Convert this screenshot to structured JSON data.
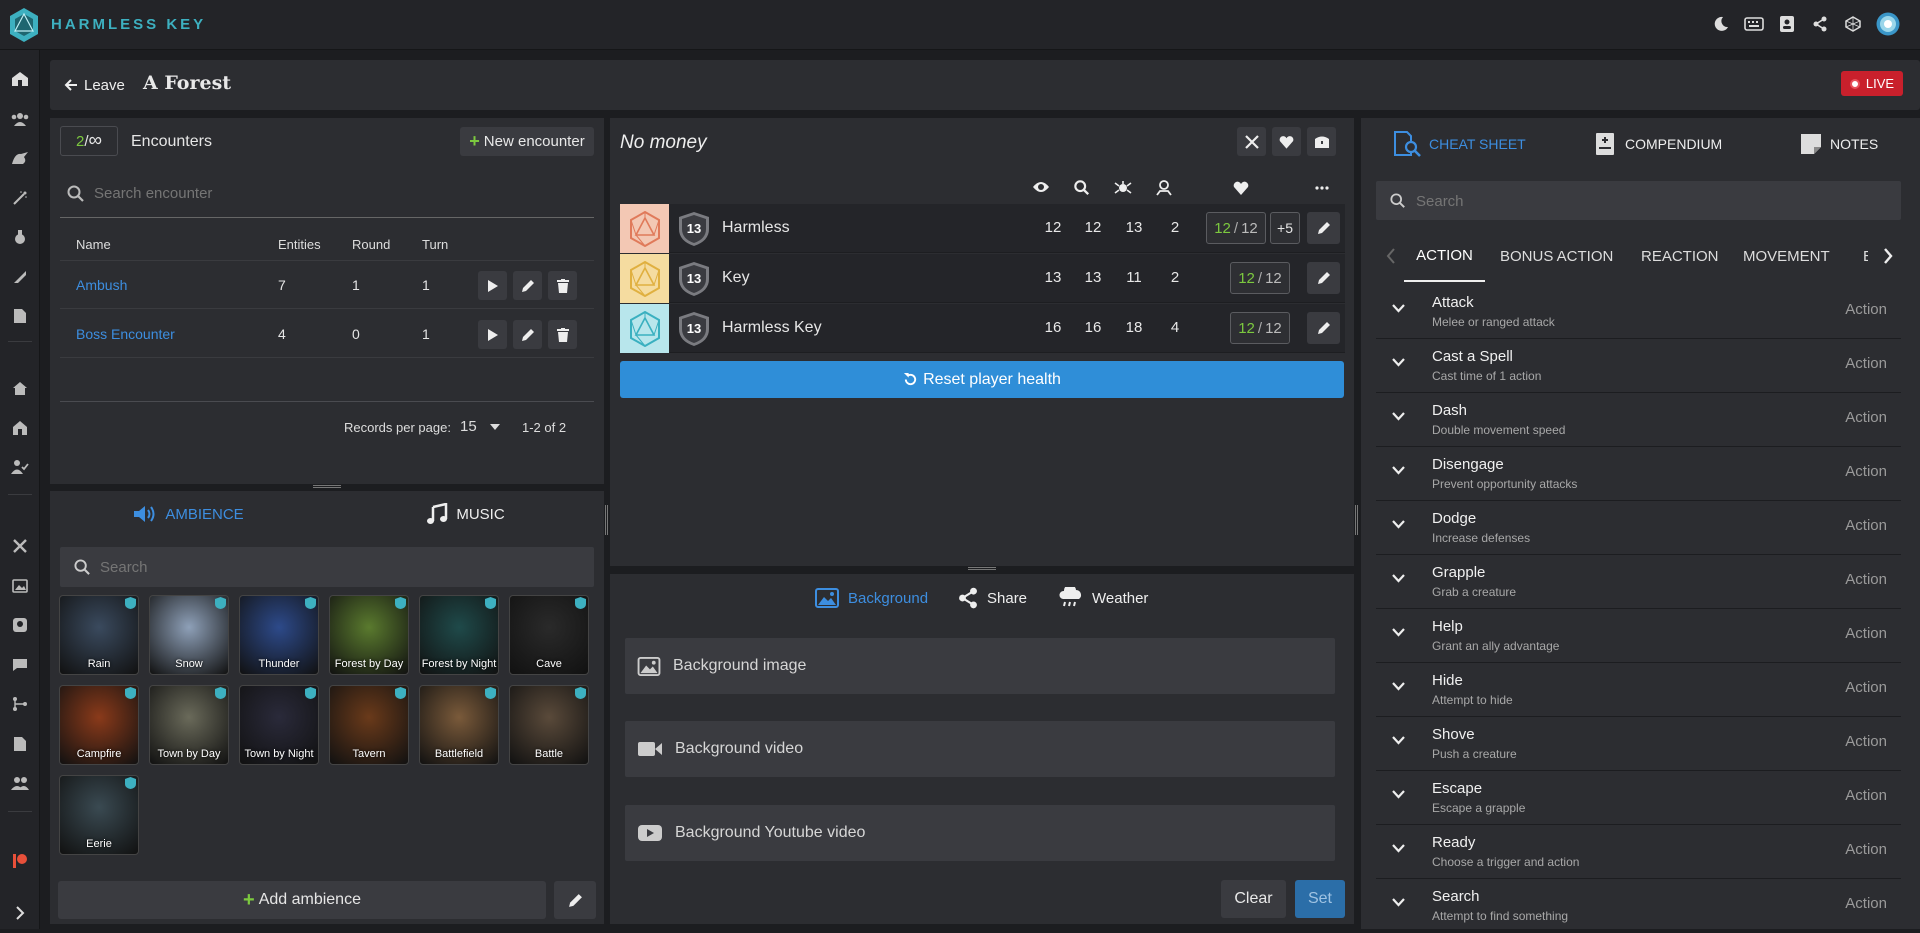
{
  "app": {
    "name": "HARMLESS KEY"
  },
  "header": {
    "leave_label": "Leave",
    "title": "A Forest",
    "live_label": "LIVE"
  },
  "encounters": {
    "count_current": "2",
    "count_sep": " / ",
    "count_max": "∞",
    "title": "Encounters",
    "new_label": "New encounter",
    "search_placeholder": "Search encounter",
    "columns": [
      "Name",
      "Entities",
      "Round",
      "Turn"
    ],
    "rows": [
      {
        "name": "Ambush",
        "entities": "7",
        "round": "1",
        "turn": "1"
      },
      {
        "name": "Boss Encounter",
        "entities": "4",
        "round": "0",
        "turn": "1"
      }
    ],
    "records_label": "Records per page:",
    "records_value": "15",
    "range": "1-2 of 2"
  },
  "ambience": {
    "tab_ambience": "AMBIENCE",
    "tab_music": "MUSIC",
    "search_placeholder": "Search",
    "tiles": [
      {
        "label": "Rain",
        "color": "#3a4a5e"
      },
      {
        "label": "Snow",
        "color": "#8ea0b8"
      },
      {
        "label": "Thunder",
        "color": "#2d4a8a"
      },
      {
        "label": "Forest by Day",
        "color": "#5a7a2e"
      },
      {
        "label": "Forest by Night",
        "color": "#1f4a4a"
      },
      {
        "label": "Cave",
        "color": "#2a2a2a"
      },
      {
        "label": "Campfire",
        "color": "#8a3a1a"
      },
      {
        "label": "Town by Day",
        "color": "#6a6a5a"
      },
      {
        "label": "Town by Night",
        "color": "#2a2a3a"
      },
      {
        "label": "Tavern",
        "color": "#6a3a1a"
      },
      {
        "label": "Battlefield",
        "color": "#7a5a3a"
      },
      {
        "label": "Battle",
        "color": "#5a4a3a"
      },
      {
        "label": "Eerie",
        "color": "#3a4a52"
      }
    ],
    "add_label": "Add ambience"
  },
  "party": {
    "title": "No money",
    "players": [
      {
        "name": "Harmless",
        "ac": "13",
        "v1": "12",
        "v2": "12",
        "v3": "13",
        "v4": "2",
        "hp": "12",
        "hp_max": "12",
        "bonus": "+5",
        "color": "#f3c8b4",
        "die": "#e07a5a"
      },
      {
        "name": "Key",
        "ac": "13",
        "v1": "13",
        "v2": "13",
        "v3": "11",
        "v4": "2",
        "hp": "12",
        "hp_max": "12",
        "bonus": "",
        "color": "#f5dca0",
        "die": "#e0b040"
      },
      {
        "name": "Harmless Key",
        "ac": "13",
        "v1": "16",
        "v2": "16",
        "v3": "18",
        "v4": "4",
        "hp": "12",
        "hp_max": "12",
        "bonus": "",
        "color": "#b8e6ec",
        "die": "#3ab0c0"
      }
    ],
    "reset_label": "Reset player health"
  },
  "background": {
    "tab_background": "Background",
    "tab_share": "Share",
    "tab_weather": "Weather",
    "rows": [
      "Background image",
      "Background video",
      "Background Youtube video"
    ],
    "clear_label": "Clear",
    "set_label": "Set"
  },
  "right": {
    "tab_cheat": "CHEAT SHEET",
    "tab_compendium": "COMPENDIUM",
    "tab_notes": "NOTES",
    "search_placeholder": "Search",
    "subtabs": [
      "ACTION",
      "BONUS ACTION",
      "REACTION",
      "MOVEMENT",
      "E"
    ],
    "actions": [
      {
        "title": "Attack",
        "sub": "Melee or ranged attack",
        "type": "Action"
      },
      {
        "title": "Cast a Spell",
        "sub": "Cast time of 1 action",
        "type": "Action"
      },
      {
        "title": "Dash",
        "sub": "Double movement speed",
        "type": "Action"
      },
      {
        "title": "Disengage",
        "sub": "Prevent opportunity attacks",
        "type": "Action"
      },
      {
        "title": "Dodge",
        "sub": "Increase defenses",
        "type": "Action"
      },
      {
        "title": "Grapple",
        "sub": "Grab a creature",
        "type": "Action"
      },
      {
        "title": "Help",
        "sub": "Grant an ally advantage",
        "type": "Action"
      },
      {
        "title": "Hide",
        "sub": "Attempt to hide",
        "type": "Action"
      },
      {
        "title": "Shove",
        "sub": "Push a creature",
        "type": "Action"
      },
      {
        "title": "Escape",
        "sub": "Escape a grapple",
        "type": "Action"
      },
      {
        "title": "Ready",
        "sub": "Choose a trigger and action",
        "type": "Action"
      },
      {
        "title": "Search",
        "sub": "Attempt to find something",
        "type": "Action"
      }
    ]
  },
  "colors": {
    "accent": "#3d8ee0",
    "green": "#7cc93f",
    "live": "#d9303a",
    "teal": "#3db0c0"
  }
}
